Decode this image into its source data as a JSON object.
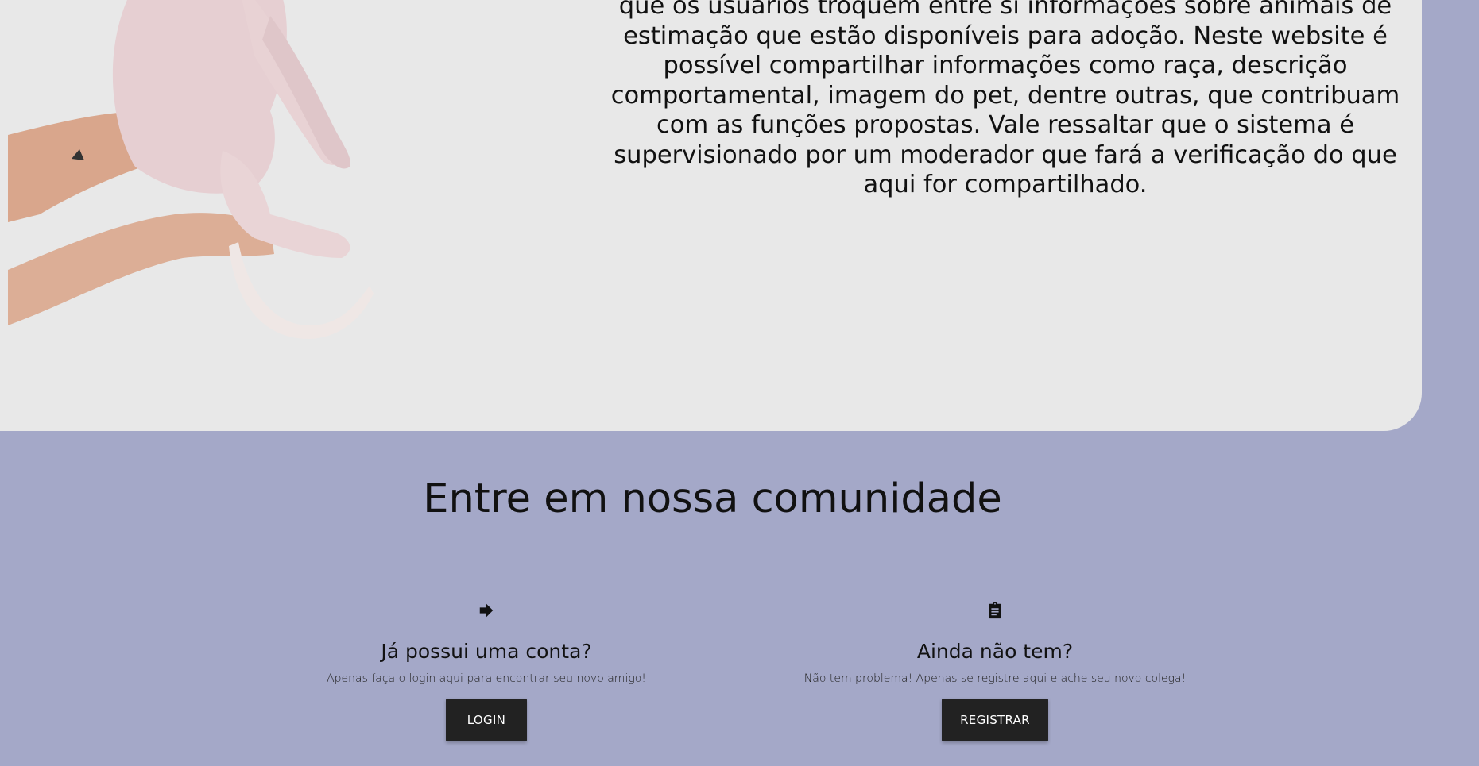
{
  "about": {
    "text": "que os usuários troquem entre si informações sobre animais de estimação que estão disponíveis para adoção. Neste website é possível compartilhar informações como raça, descrição comportamental, imagem do pet, dentre outras, que contribuam com as funções propostas. Vale ressaltar que o sistema é supervisionado por um moderador que fará a verificação do que aqui for compartilhado."
  },
  "community": {
    "title": "Entre em nossa comunidade",
    "login": {
      "icon": "arrow-right-icon",
      "heading": "Já possui uma conta?",
      "description": "Apenas faça o login aqui para encontrar seu novo amigo!",
      "button_label": "LOGIN"
    },
    "register": {
      "icon": "clipboard-icon",
      "heading": "Ainda não tem?",
      "description": "Não tem problema! Apenas se registre aqui e ache seu novo colega!",
      "button_label": "REGISTRAR"
    }
  },
  "colors": {
    "page_background": "#a4a8c8",
    "card_background": "#e8e8e8",
    "button_background": "#222222",
    "button_text": "#ffffff"
  }
}
